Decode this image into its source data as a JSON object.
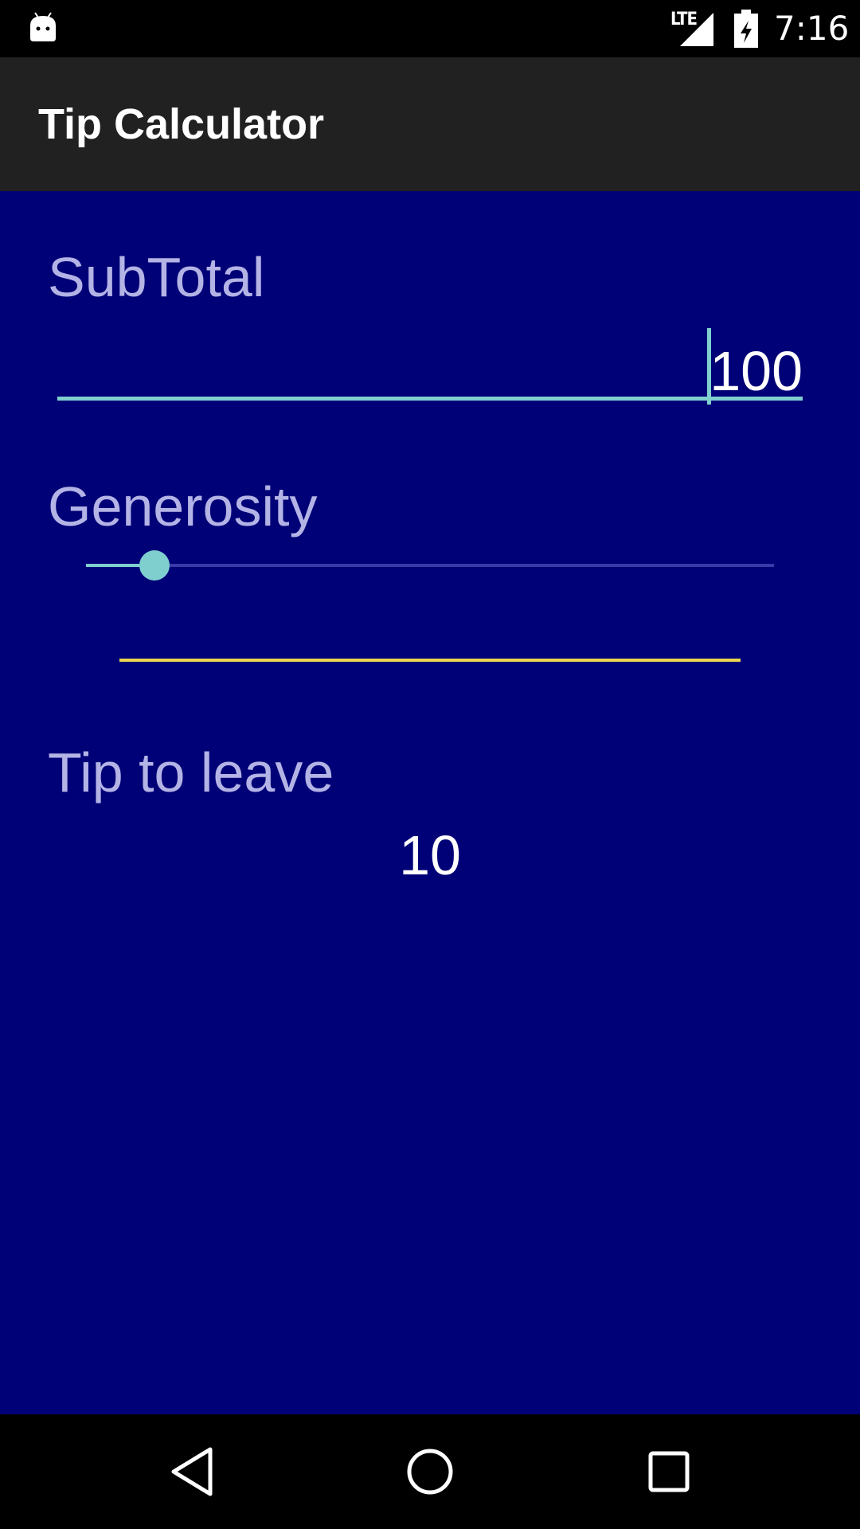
{
  "status_bar": {
    "time": "7:16",
    "network": "LTE",
    "icons": [
      "android-icon",
      "signal-icon",
      "battery-charging-icon"
    ]
  },
  "app_bar": {
    "title": "Tip Calculator"
  },
  "form": {
    "subtotal_label": "SubTotal",
    "subtotal_value": "100",
    "generosity_label": "Generosity",
    "generosity_slider_fraction": 0.1,
    "tip_label": "Tip to leave",
    "tip_value": "10"
  },
  "colors": {
    "background": "#000077",
    "app_bar": "#212121",
    "accent": "#7fcfcf",
    "label": "#b3b3e6",
    "divider": "#e8d44d"
  },
  "nav_bar": {
    "icons": [
      "back-icon",
      "home-icon",
      "recents-icon"
    ]
  }
}
